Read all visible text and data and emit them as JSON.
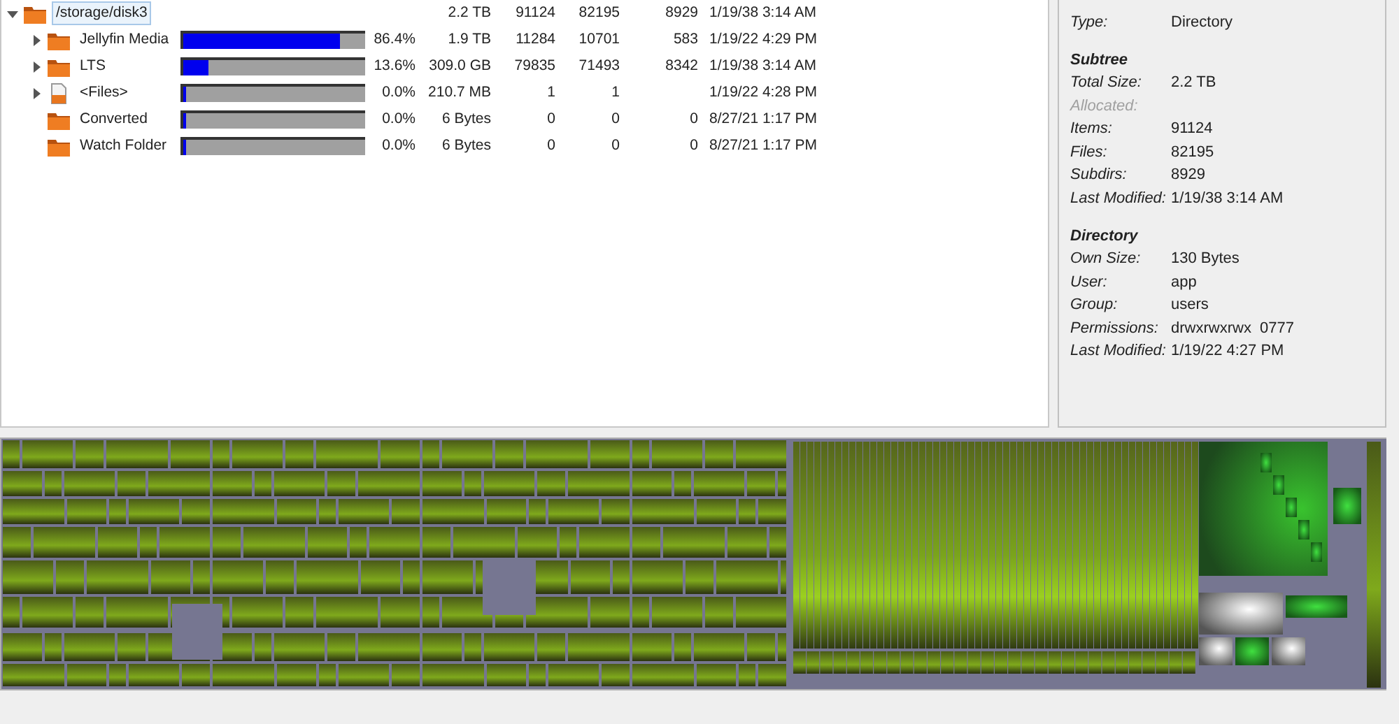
{
  "tree": {
    "rows": [
      {
        "name": "/storage/disk3",
        "kind": "folder",
        "selected": true,
        "expanded": true,
        "size": "2.2 TB",
        "items": "91124",
        "files": "82195",
        "subdirs": "8929",
        "modified": "1/19/38 3:14 AM",
        "children": [
          {
            "name": "Jellyfin Media",
            "kind": "folder",
            "selected": false,
            "expanded": false,
            "has_children": true,
            "level": 0.864,
            "percent": "86.4%",
            "size": "1.9 TB",
            "items": "11284",
            "files": "10701",
            "subdirs": "583",
            "modified": "1/19/22 4:29 PM"
          },
          {
            "name": "LTS",
            "kind": "folder",
            "selected": false,
            "expanded": false,
            "has_children": true,
            "level": 0.136,
            "percent": "13.6%",
            "size": "309.0 GB",
            "items": "79835",
            "files": "71493",
            "subdirs": "8342",
            "modified": "1/19/38 3:14 AM"
          },
          {
            "name": "<Files>",
            "kind": "files",
            "selected": false,
            "expanded": false,
            "has_children": true,
            "level": 0.0,
            "percent": "0.0%",
            "size": "210.7 MB",
            "items": "1",
            "files": "1",
            "modified": "1/19/22 4:28 PM"
          },
          {
            "name": "Converted",
            "kind": "folder",
            "selected": false,
            "has_children": false,
            "level": 0.0,
            "percent": "0.0%",
            "size": "6 Bytes",
            "items": "0",
            "files": "0",
            "subdirs": "0",
            "modified": "8/27/21 1:17 PM"
          },
          {
            "name": "Watch Folder",
            "kind": "folder",
            "selected": false,
            "has_children": false,
            "level": 0.0,
            "percent": "0.0%",
            "size": "6 Bytes",
            "items": "0",
            "files": "0",
            "subdirs": "0",
            "modified": "8/27/21 1:17 PM"
          }
        ]
      }
    ]
  },
  "details": {
    "type": {
      "label": "Type:",
      "value": "Directory"
    },
    "sections": [
      {
        "title": "Subtree",
        "fields": [
          {
            "label": "Total Size:",
            "value": "2.2 TB",
            "disabled": false
          },
          {
            "label": "Allocated:",
            "disabled": true
          },
          {
            "label": "Items:",
            "value": "91124",
            "disabled": false
          },
          {
            "label": "Files:",
            "value": "82195",
            "disabled": false
          },
          {
            "label": "Subdirs:",
            "value": "8929",
            "disabled": false
          },
          {
            "label": "Last Modified:",
            "value": "1/19/38 3:14 AM",
            "disabled": false
          }
        ]
      },
      {
        "title": "Directory",
        "fields": [
          {
            "label": "Own Size:",
            "value": "130 Bytes",
            "disabled": false
          },
          {
            "label": "User:",
            "value": "app",
            "disabled": false
          },
          {
            "label": "Group:",
            "value": "users",
            "disabled": false
          },
          {
            "label": "Permissions:",
            "value": "drwxrwxrwx  0777",
            "disabled": false
          },
          {
            "label": "Last Modified:",
            "value": "1/19/22 4:27 PM",
            "disabled": false
          }
        ]
      }
    ]
  }
}
